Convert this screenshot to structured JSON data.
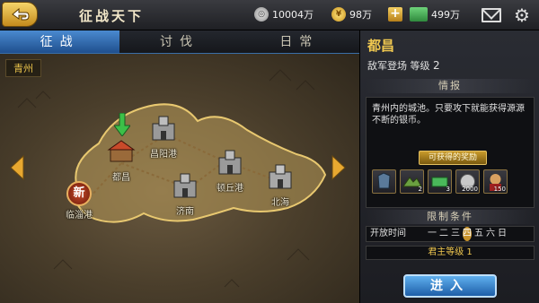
{
  "topbar": {
    "title": "征战天下",
    "silver": "10004万",
    "gold": "98万",
    "cash": "499万",
    "icons": [
      "back-arrow-icon",
      "silver-coin-icon",
      "gold-coin-icon",
      "plus-icon",
      "cash-icon",
      "mail-icon",
      "gear-icon"
    ]
  },
  "tabs": [
    {
      "label": "征战",
      "active": true
    },
    {
      "label": "讨伐",
      "active": false
    },
    {
      "label": "日常",
      "active": false
    }
  ],
  "map": {
    "region": "青州",
    "cities": [
      {
        "name": "都昌",
        "kind": "camp"
      },
      {
        "name": "昌阳港",
        "kind": "fort"
      },
      {
        "name": "顿丘港",
        "kind": "fort"
      },
      {
        "name": "济南",
        "kind": "fort"
      },
      {
        "name": "北海",
        "kind": "fort"
      },
      {
        "name": "临淄港",
        "kind": "new"
      }
    ],
    "new_badge": "新"
  },
  "panel": {
    "city_name": "都昌",
    "subtitle": "敌军登场 等级",
    "level": "2",
    "info_head": "情报",
    "info_text": "青州内的城池。只要攻下就能获得源源不断的银币。",
    "reward_label": "可获得的奖励",
    "rewards": [
      {
        "icon": "armor-icon",
        "count": ""
      },
      {
        "icon": "terrain-icon",
        "count": "2"
      },
      {
        "icon": "cash-icon",
        "count": "3"
      },
      {
        "icon": "silver-coin-icon",
        "count": "2000"
      },
      {
        "icon": "general-icon",
        "count": "150"
      }
    ],
    "cond_head": "限制条件",
    "open_label": "开放时间",
    "days": [
      "一",
      "二",
      "三",
      "四",
      "五",
      "六",
      "日"
    ],
    "highlight_day": "四",
    "lord_level": "君主等级 1",
    "enter": "进入"
  }
}
